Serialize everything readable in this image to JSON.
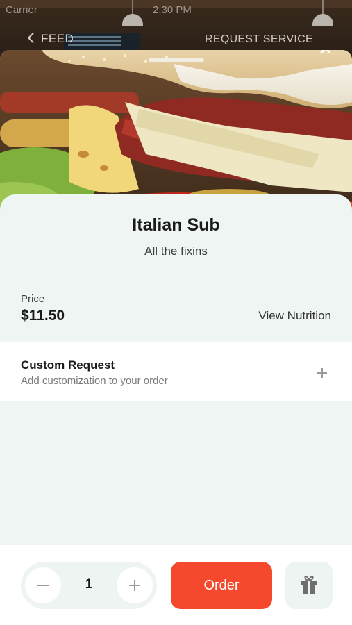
{
  "status_bar": {
    "carrier": "Carrier",
    "time": "2:30 PM"
  },
  "background_nav": {
    "back_label": "FEED",
    "request_label": "REQUEST SERVICE"
  },
  "item": {
    "title": "Italian Sub",
    "subtitle": "All the fixins",
    "price_label": "Price",
    "price": "$11.50",
    "nutrition_link": "View Nutrition"
  },
  "custom_request": {
    "title": "Custom Request",
    "subtitle": "Add customization to your order"
  },
  "footer": {
    "quantity": "1",
    "order_label": "Order"
  },
  "colors": {
    "accent": "#f4492d",
    "surface": "#eef5f2",
    "card": "#ffffff"
  },
  "icons": [
    "close-icon",
    "plus-icon",
    "minus-icon",
    "gift-icon",
    "chevron-left-icon"
  ]
}
